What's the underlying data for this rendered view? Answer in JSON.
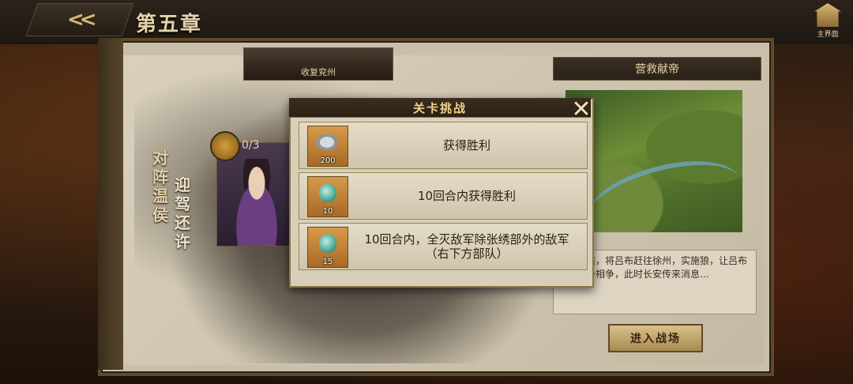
{
  "header": {
    "title": "第五章",
    "home_label": "主界面"
  },
  "stage": {
    "mission_card_label": "收复兖州",
    "title": "对阵温侯",
    "subtitle": "迎驾还许",
    "progress": "0/3"
  },
  "right_panel": {
    "title": "营救献帝",
    "description": "谋计策，将吕布赶往徐州，实施狼，让吕布与刘备相争，此时长安传来消息…",
    "enter_button": "进入战场"
  },
  "modal": {
    "title": "关卡挑战",
    "tasks": [
      {
        "label": "获得胜利",
        "reward_icon": "silver-coins-icon",
        "qty": "200"
      },
      {
        "label": "10回合内获得胜利",
        "reward_icon": "jade-pouch-icon",
        "qty": "10"
      },
      {
        "label": "10回合内，全灭敌军除张绣部外的敌军（右下方部队）",
        "reward_icon": "jade-pouch-icon",
        "qty": "15"
      }
    ]
  },
  "colors": {
    "accent_gold": "#d9b874",
    "frame_brown": "#5e4a28",
    "parchment": "#d9cfb8"
  }
}
